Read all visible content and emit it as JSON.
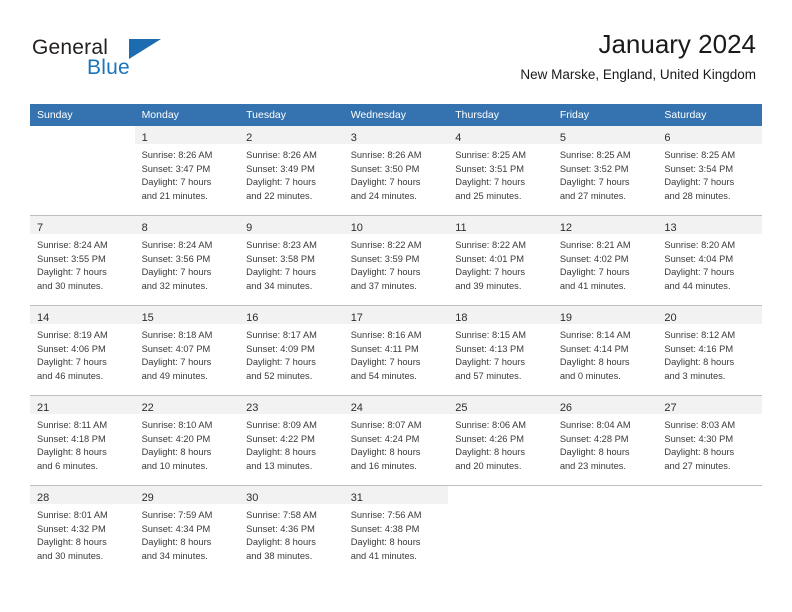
{
  "brand": {
    "name_part1": "General",
    "name_part2": "Blue",
    "logo_icon": "triangle-logo-icon",
    "accent_color": "#1b75bb"
  },
  "header": {
    "title": "January 2024",
    "subtitle": "New Marske, England, United Kingdom"
  },
  "theme": {
    "header_row_bg": "#3572b0",
    "daynum_bg": "#f2f2f2",
    "grid_line": "#bfbfbf"
  },
  "weekdays": [
    "Sunday",
    "Monday",
    "Tuesday",
    "Wednesday",
    "Thursday",
    "Friday",
    "Saturday"
  ],
  "weeks": [
    [
      {
        "day": "",
        "lines": []
      },
      {
        "day": "1",
        "lines": [
          "Sunrise: 8:26 AM",
          "Sunset: 3:47 PM",
          "Daylight: 7 hours",
          "and 21 minutes."
        ]
      },
      {
        "day": "2",
        "lines": [
          "Sunrise: 8:26 AM",
          "Sunset: 3:49 PM",
          "Daylight: 7 hours",
          "and 22 minutes."
        ]
      },
      {
        "day": "3",
        "lines": [
          "Sunrise: 8:26 AM",
          "Sunset: 3:50 PM",
          "Daylight: 7 hours",
          "and 24 minutes."
        ]
      },
      {
        "day": "4",
        "lines": [
          "Sunrise: 8:25 AM",
          "Sunset: 3:51 PM",
          "Daylight: 7 hours",
          "and 25 minutes."
        ]
      },
      {
        "day": "5",
        "lines": [
          "Sunrise: 8:25 AM",
          "Sunset: 3:52 PM",
          "Daylight: 7 hours",
          "and 27 minutes."
        ]
      },
      {
        "day": "6",
        "lines": [
          "Sunrise: 8:25 AM",
          "Sunset: 3:54 PM",
          "Daylight: 7 hours",
          "and 28 minutes."
        ]
      }
    ],
    [
      {
        "day": "7",
        "lines": [
          "Sunrise: 8:24 AM",
          "Sunset: 3:55 PM",
          "Daylight: 7 hours",
          "and 30 minutes."
        ]
      },
      {
        "day": "8",
        "lines": [
          "Sunrise: 8:24 AM",
          "Sunset: 3:56 PM",
          "Daylight: 7 hours",
          "and 32 minutes."
        ]
      },
      {
        "day": "9",
        "lines": [
          "Sunrise: 8:23 AM",
          "Sunset: 3:58 PM",
          "Daylight: 7 hours",
          "and 34 minutes."
        ]
      },
      {
        "day": "10",
        "lines": [
          "Sunrise: 8:22 AM",
          "Sunset: 3:59 PM",
          "Daylight: 7 hours",
          "and 37 minutes."
        ]
      },
      {
        "day": "11",
        "lines": [
          "Sunrise: 8:22 AM",
          "Sunset: 4:01 PM",
          "Daylight: 7 hours",
          "and 39 minutes."
        ]
      },
      {
        "day": "12",
        "lines": [
          "Sunrise: 8:21 AM",
          "Sunset: 4:02 PM",
          "Daylight: 7 hours",
          "and 41 minutes."
        ]
      },
      {
        "day": "13",
        "lines": [
          "Sunrise: 8:20 AM",
          "Sunset: 4:04 PM",
          "Daylight: 7 hours",
          "and 44 minutes."
        ]
      }
    ],
    [
      {
        "day": "14",
        "lines": [
          "Sunrise: 8:19 AM",
          "Sunset: 4:06 PM",
          "Daylight: 7 hours",
          "and 46 minutes."
        ]
      },
      {
        "day": "15",
        "lines": [
          "Sunrise: 8:18 AM",
          "Sunset: 4:07 PM",
          "Daylight: 7 hours",
          "and 49 minutes."
        ]
      },
      {
        "day": "16",
        "lines": [
          "Sunrise: 8:17 AM",
          "Sunset: 4:09 PM",
          "Daylight: 7 hours",
          "and 52 minutes."
        ]
      },
      {
        "day": "17",
        "lines": [
          "Sunrise: 8:16 AM",
          "Sunset: 4:11 PM",
          "Daylight: 7 hours",
          "and 54 minutes."
        ]
      },
      {
        "day": "18",
        "lines": [
          "Sunrise: 8:15 AM",
          "Sunset: 4:13 PM",
          "Daylight: 7 hours",
          "and 57 minutes."
        ]
      },
      {
        "day": "19",
        "lines": [
          "Sunrise: 8:14 AM",
          "Sunset: 4:14 PM",
          "Daylight: 8 hours",
          "and 0 minutes."
        ]
      },
      {
        "day": "20",
        "lines": [
          "Sunrise: 8:12 AM",
          "Sunset: 4:16 PM",
          "Daylight: 8 hours",
          "and 3 minutes."
        ]
      }
    ],
    [
      {
        "day": "21",
        "lines": [
          "Sunrise: 8:11 AM",
          "Sunset: 4:18 PM",
          "Daylight: 8 hours",
          "and 6 minutes."
        ]
      },
      {
        "day": "22",
        "lines": [
          "Sunrise: 8:10 AM",
          "Sunset: 4:20 PM",
          "Daylight: 8 hours",
          "and 10 minutes."
        ]
      },
      {
        "day": "23",
        "lines": [
          "Sunrise: 8:09 AM",
          "Sunset: 4:22 PM",
          "Daylight: 8 hours",
          "and 13 minutes."
        ]
      },
      {
        "day": "24",
        "lines": [
          "Sunrise: 8:07 AM",
          "Sunset: 4:24 PM",
          "Daylight: 8 hours",
          "and 16 minutes."
        ]
      },
      {
        "day": "25",
        "lines": [
          "Sunrise: 8:06 AM",
          "Sunset: 4:26 PM",
          "Daylight: 8 hours",
          "and 20 minutes."
        ]
      },
      {
        "day": "26",
        "lines": [
          "Sunrise: 8:04 AM",
          "Sunset: 4:28 PM",
          "Daylight: 8 hours",
          "and 23 minutes."
        ]
      },
      {
        "day": "27",
        "lines": [
          "Sunrise: 8:03 AM",
          "Sunset: 4:30 PM",
          "Daylight: 8 hours",
          "and 27 minutes."
        ]
      }
    ],
    [
      {
        "day": "28",
        "lines": [
          "Sunrise: 8:01 AM",
          "Sunset: 4:32 PM",
          "Daylight: 8 hours",
          "and 30 minutes."
        ]
      },
      {
        "day": "29",
        "lines": [
          "Sunrise: 7:59 AM",
          "Sunset: 4:34 PM",
          "Daylight: 8 hours",
          "and 34 minutes."
        ]
      },
      {
        "day": "30",
        "lines": [
          "Sunrise: 7:58 AM",
          "Sunset: 4:36 PM",
          "Daylight: 8 hours",
          "and 38 minutes."
        ]
      },
      {
        "day": "31",
        "lines": [
          "Sunrise: 7:56 AM",
          "Sunset: 4:38 PM",
          "Daylight: 8 hours",
          "and 41 minutes."
        ]
      },
      {
        "day": "",
        "lines": []
      },
      {
        "day": "",
        "lines": []
      },
      {
        "day": "",
        "lines": []
      }
    ]
  ]
}
